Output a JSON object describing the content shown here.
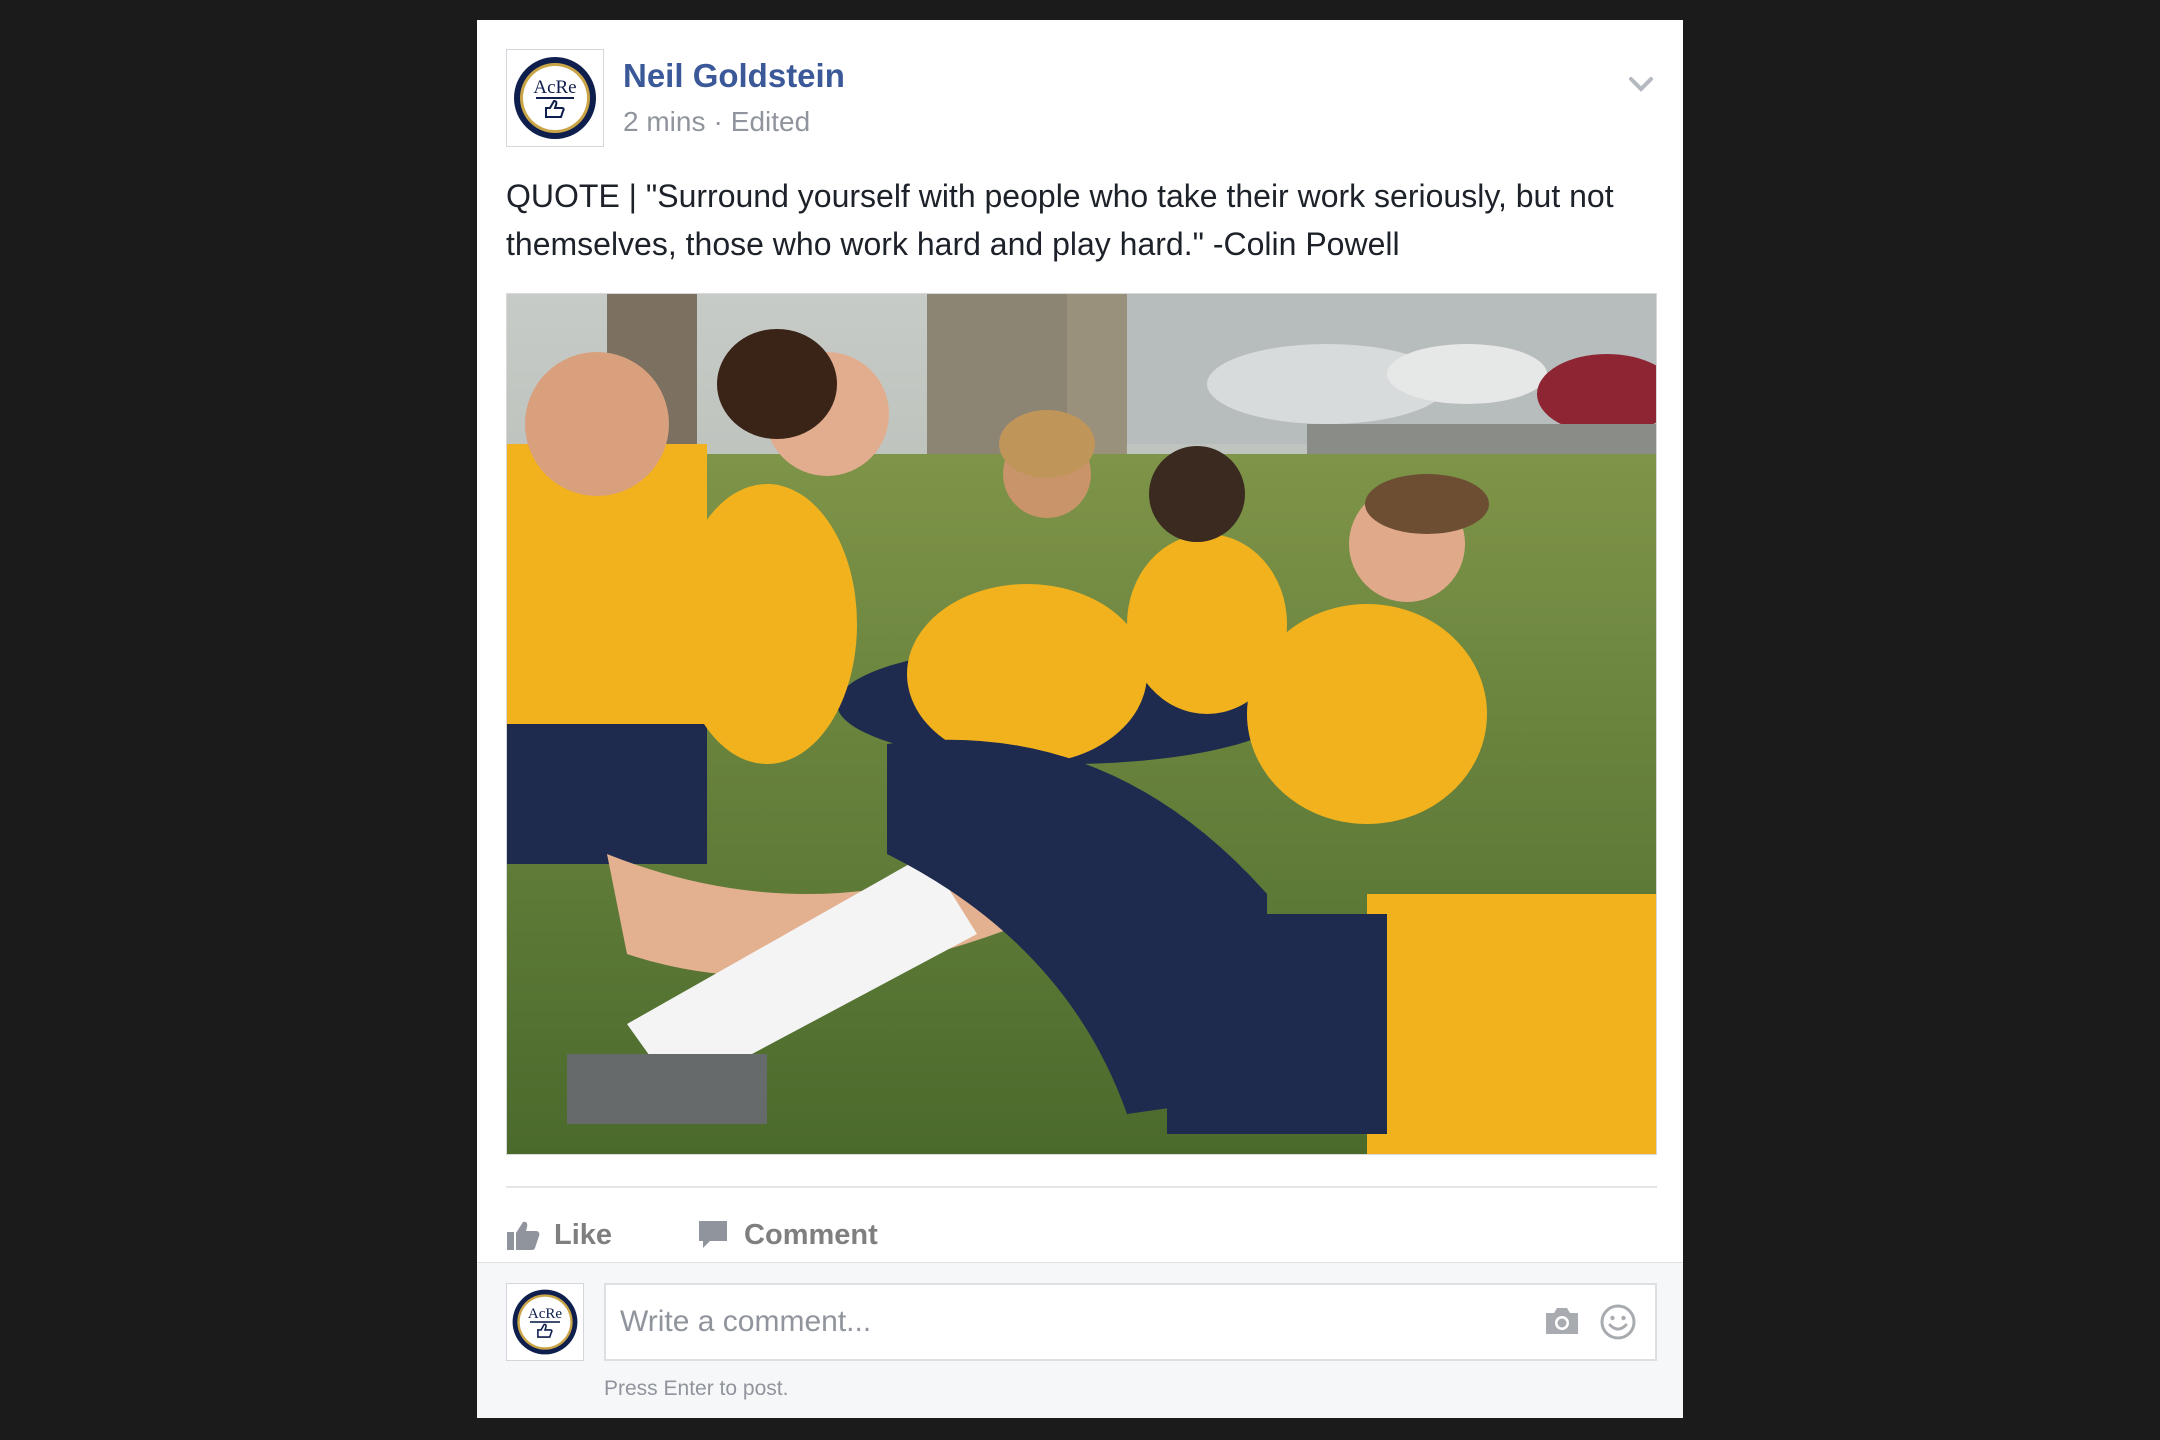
{
  "post": {
    "author": "Neil Goldstein",
    "time": "2 mins",
    "separator": "·",
    "edited": "Edited",
    "text": "QUOTE | \"Surround yourself with people who take their work seriously, but not themselves, those who work hard and play hard.\" -Colin Powell",
    "avatar_text": "AcRe"
  },
  "actions": {
    "like_label": "Like",
    "comment_label": "Comment"
  },
  "comment": {
    "placeholder": "Write a comment...",
    "hint": "Press Enter to post."
  },
  "icons": {
    "options": "chevron-down-icon",
    "like": "thumbs-up-icon",
    "comment": "speech-bubble-icon",
    "camera": "camera-icon",
    "emoji": "smiley-icon"
  },
  "colors": {
    "author_link": "#3b5998",
    "meta_text": "#90949c",
    "action_text": "#7f7f7f",
    "page_background": "#1b1b1b",
    "shirt_yellow": "#f2b21e",
    "shorts_navy": "#1e2b4f"
  }
}
